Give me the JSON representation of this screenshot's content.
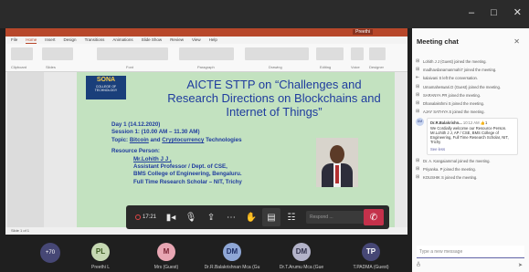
{
  "window": {
    "minimize": "–",
    "maximize": "□",
    "close": "✕"
  },
  "ppt": {
    "user": "Preethi",
    "menu": [
      "File",
      "Home",
      "Insert",
      "Design",
      "Transitions",
      "Animations",
      "Slide Show",
      "Review",
      "View",
      "Help"
    ],
    "ribbon_groups": [
      "Clipboard",
      "Slides",
      "Font",
      "Paragraph",
      "Drawing",
      "Editing",
      "Voice",
      "Designer"
    ],
    "status": "Slide 1 of 1"
  },
  "slide": {
    "logo_main": "SONA",
    "logo_sub": "COLLEGE OF TECHNOLOGY",
    "title": "AICTE STTP on “Challenges and Research Directions on Blockchains and Internet of Things”",
    "day": "Day 1 (14.12.2020)",
    "session": "Session 1: (10.00 AM – 11.30 AM)",
    "topic_label": "Topic:",
    "topic_a": "Bitcoin",
    "topic_and": "and",
    "topic_b": "Cryptocurrency",
    "topic_rest": "Technologies",
    "resource_label": "Resource Person:",
    "rp_name": "Mr.Lohith J J ,",
    "rp_line1": "Assistant Professor / Dept. of CSE,",
    "rp_line2": "BMS College of Engineering, Bengaluru.",
    "rp_line3": "Full Time Research Scholar – NIT, Trichy"
  },
  "controls": {
    "timer": "17:21",
    "reaction_placeholder": "Respond ...",
    "hangup": "✆",
    "icons": [
      "video-icon",
      "mic-icon",
      "share-icon",
      "more-icon",
      "hand-icon",
      "chat-icon",
      "people-icon"
    ]
  },
  "participants": {
    "more_count": "+70",
    "tiles": [
      {
        "initials": "PL",
        "name": "Preethi L",
        "color": "#c6d9b3",
        "text": "#3c5a20"
      },
      {
        "initials": "M",
        "name": "Mrs (Guest)",
        "color": "#e8a6b3",
        "text": "#7a2434"
      },
      {
        "initials": "DM",
        "name": "Dr.R.Balakrishnan Mca (Gu",
        "color": "#8fa7d6",
        "text": "#1f2f66"
      },
      {
        "initials": "DM",
        "name": "Dr.T.Arumu Mca (Gue",
        "color": "#b3b3c9",
        "text": "#33334d"
      },
      {
        "initials": "TP",
        "name": "T.PADMA (Guest)",
        "color": "#464775",
        "text": "#ffffff"
      }
    ]
  },
  "chat": {
    "title": "Meeting chat",
    "close": "✕",
    "events_before": [
      "Lohith J J (Guest) joined the meeting.",
      "madhavdanamanmahi7 joined the meeting.",
      "kalaivani S left the conversation.",
      "Umamaheswari.D (Guest) joined the meeting.",
      "SARANYA PR joined the meeting.",
      "Dhanalakshmi S joined the meeting.",
      "AJAY SATHYA S joined the meeting."
    ],
    "message": {
      "avatar": "DM",
      "author": "Dr.R.Balakrishn...",
      "time": "10:12 AM",
      "likes": "1",
      "text": "We Cordially welcome our Resource Person. Mr.Lohith J J, AP / CSE, BMS College of Engineering, Full Time Research Scholar, NIT, Trichy",
      "see_more": "See less"
    },
    "events_after": [
      "Dr. A. Kangaiammal joined the meeting.",
      "Priyanka. P joined the meeting.",
      "KOUSHIK S joined the meeting."
    ],
    "compose_placeholder": "Type a new message"
  }
}
